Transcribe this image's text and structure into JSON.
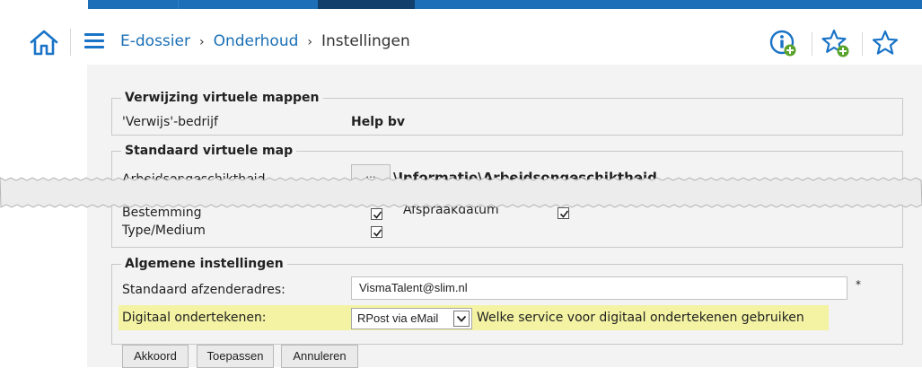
{
  "header": {
    "breadcrumb": {
      "item1": "E-dossier",
      "item2": "Onderhoud",
      "current": "Instellingen",
      "separator": "›"
    }
  },
  "sections": {
    "verwijzing": {
      "title": "Verwijzing virtuele mappen",
      "label": "'Verwijs'-bedrijf",
      "value": "Help bv"
    },
    "standaard_map": {
      "title": "Standaard virtuele map",
      "arbeid_label": "Arbeidsongeschiktheid",
      "browse_label": "...",
      "arbeid_path": "\\Informatie\\Arbeidsongeschiktheid",
      "bestemming_label": "Bestemming",
      "bestemming_checked": true,
      "afspraak_label": "Afspraakdatum",
      "afspraak_checked": true,
      "type_label": "Type/Medium",
      "type_checked": true
    },
    "algemeen": {
      "title": "Algemene instellingen",
      "afzender_label": "Standaard afzenderadres:",
      "afzender_value": "VismaTalent@slim.nl",
      "required_mark": "*",
      "digitaal_label": "Digitaal ondertekenen:",
      "digitaal_selected": "RPost via eMail",
      "digitaal_help": "Welke service voor digitaal ondertekenen gebruiken"
    }
  },
  "buttons": {
    "akkoord": "Akkoord",
    "toepassen": "Toepassen",
    "annuleren": "Annuleren"
  },
  "colors": {
    "accent": "#1a6fb5",
    "highlight": "#f3f3a3",
    "icon_green": "#5aa32a"
  },
  "icons": {
    "home": "home-icon",
    "menu": "menu-icon",
    "info_add": "info-add-icon",
    "favorite_add": "favorite-add-icon",
    "favorites": "favorites-icon"
  }
}
